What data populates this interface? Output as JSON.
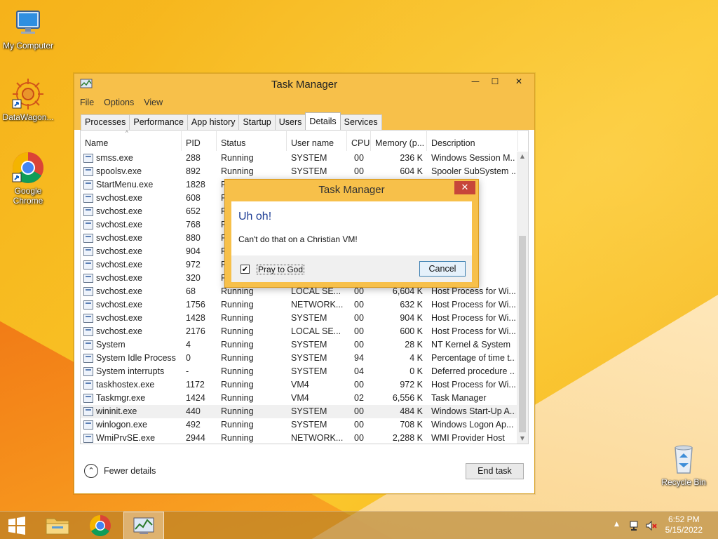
{
  "desktop": {
    "icons": [
      {
        "label": "My Computer"
      },
      {
        "label": "DataWagon..."
      },
      {
        "label": "Google Chrome"
      },
      {
        "label": "Recycle Bin"
      }
    ]
  },
  "window": {
    "title": "Task Manager",
    "controls": {
      "minimize": "—",
      "maximize": "☐",
      "close": "✕"
    },
    "menu": [
      "File",
      "Options",
      "View"
    ],
    "tabs": [
      "Processes",
      "Performance",
      "App history",
      "Startup",
      "Users",
      "Details",
      "Services"
    ],
    "active_tab": "Details",
    "columns": [
      "Name",
      "PID",
      "Status",
      "User name",
      "CPU",
      "Memory (p...",
      "Description"
    ],
    "rows": [
      {
        "name": "smss.exe",
        "pid": "288",
        "status": "Running",
        "user": "SYSTEM",
        "cpu": "00",
        "mem": "236 K",
        "desc": "Windows Session M..."
      },
      {
        "name": "spoolsv.exe",
        "pid": "892",
        "status": "Running",
        "user": "SYSTEM",
        "cpu": "00",
        "mem": "604 K",
        "desc": "Spooler SubSystem ..."
      },
      {
        "name": "StartMenu.exe",
        "pid": "1828",
        "status": "R",
        "user": "",
        "cpu": "",
        "mem": "",
        "desc": "enu"
      },
      {
        "name": "svchost.exe",
        "pid": "608",
        "status": "R",
        "user": "",
        "cpu": "",
        "mem": "",
        "desc": "for Wi..."
      },
      {
        "name": "svchost.exe",
        "pid": "652",
        "status": "R",
        "user": "",
        "cpu": "",
        "mem": "",
        "desc": "for Wi..."
      },
      {
        "name": "svchost.exe",
        "pid": "768",
        "status": "R",
        "user": "",
        "cpu": "",
        "mem": "",
        "desc": "for Wi..."
      },
      {
        "name": "svchost.exe",
        "pid": "880",
        "status": "R",
        "user": "",
        "cpu": "",
        "mem": "",
        "desc": "for Wi..."
      },
      {
        "name": "svchost.exe",
        "pid": "904",
        "status": "R",
        "user": "",
        "cpu": "",
        "mem": "",
        "desc": "for Wi..."
      },
      {
        "name": "svchost.exe",
        "pid": "972",
        "status": "R",
        "user": "",
        "cpu": "",
        "mem": "",
        "desc": "for Wi..."
      },
      {
        "name": "svchost.exe",
        "pid": "320",
        "status": "R",
        "user": "",
        "cpu": "",
        "mem": "",
        "desc": "for Wi..."
      },
      {
        "name": "svchost.exe",
        "pid": "68",
        "status": "Running",
        "user": "LOCAL SE...",
        "cpu": "00",
        "mem": "6,604 K",
        "desc": "Host Process for Wi..."
      },
      {
        "name": "svchost.exe",
        "pid": "1756",
        "status": "Running",
        "user": "NETWORK...",
        "cpu": "00",
        "mem": "632 K",
        "desc": "Host Process for Wi..."
      },
      {
        "name": "svchost.exe",
        "pid": "1428",
        "status": "Running",
        "user": "SYSTEM",
        "cpu": "00",
        "mem": "904 K",
        "desc": "Host Process for Wi..."
      },
      {
        "name": "svchost.exe",
        "pid": "2176",
        "status": "Running",
        "user": "LOCAL SE...",
        "cpu": "00",
        "mem": "600 K",
        "desc": "Host Process for Wi..."
      },
      {
        "name": "System",
        "pid": "4",
        "status": "Running",
        "user": "SYSTEM",
        "cpu": "00",
        "mem": "28 K",
        "desc": "NT Kernel & System"
      },
      {
        "name": "System Idle Process",
        "pid": "0",
        "status": "Running",
        "user": "SYSTEM",
        "cpu": "94",
        "mem": "4 K",
        "desc": "Percentage of time t..."
      },
      {
        "name": "System interrupts",
        "pid": "-",
        "status": "Running",
        "user": "SYSTEM",
        "cpu": "04",
        "mem": "0 K",
        "desc": "Deferred procedure ..."
      },
      {
        "name": "taskhostex.exe",
        "pid": "1172",
        "status": "Running",
        "user": "VM4",
        "cpu": "00",
        "mem": "972 K",
        "desc": "Host Process for Wi..."
      },
      {
        "name": "Taskmgr.exe",
        "pid": "1424",
        "status": "Running",
        "user": "VM4",
        "cpu": "02",
        "mem": "6,556 K",
        "desc": "Task Manager"
      },
      {
        "name": "wininit.exe",
        "pid": "440",
        "status": "Running",
        "user": "SYSTEM",
        "cpu": "00",
        "mem": "484 K",
        "desc": "Windows Start-Up A..."
      },
      {
        "name": "winlogon.exe",
        "pid": "492",
        "status": "Running",
        "user": "SYSTEM",
        "cpu": "00",
        "mem": "708 K",
        "desc": "Windows Logon Ap..."
      },
      {
        "name": "WmiPrvSE.exe",
        "pid": "2944",
        "status": "Running",
        "user": "NETWORK...",
        "cpu": "00",
        "mem": "2,288 K",
        "desc": "WMI Provider Host"
      }
    ],
    "selected_row": "wininit.exe",
    "fewer_details": "Fewer details",
    "end_task": "End task"
  },
  "dialog": {
    "title": "Task Manager",
    "close": "✕",
    "main_instruction": "Uh oh!",
    "content": "Can't do that on a Christian VM!",
    "checkbox_label": "Pray to God",
    "checkbox_checked": true,
    "checkbox_mark": "✔",
    "cancel": "Cancel"
  },
  "taskbar": {
    "time": "6:52 PM",
    "date": "5/15/2022",
    "tray_chevron": "▲"
  }
}
